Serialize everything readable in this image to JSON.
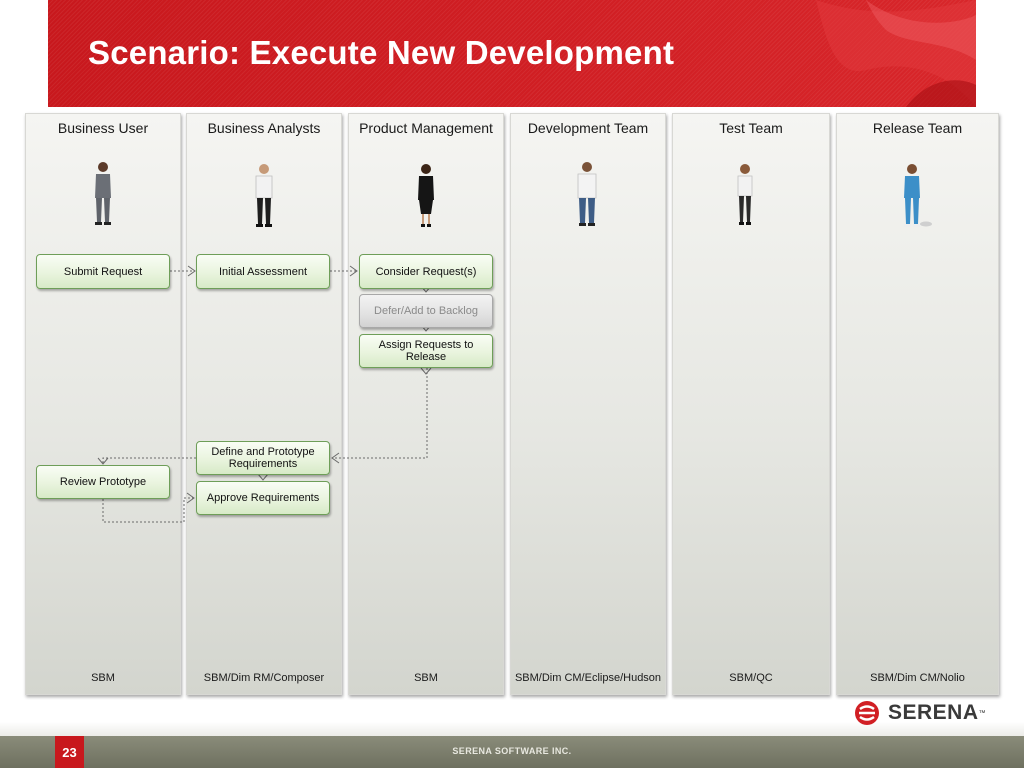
{
  "slide": {
    "title": "Scenario: Execute New Development",
    "page_number": "23",
    "company": "SERENA SOFTWARE INC.",
    "logo_text": "SERENA",
    "logo_tm": "™"
  },
  "colors": {
    "banner_red": "#c8181d",
    "task_border": "#6e9e58",
    "task_fill": "#e9f4de",
    "footer": "#6e705f"
  },
  "lanes": [
    {
      "title": "Business User",
      "tool": "SBM",
      "person_color": "#6b6f76"
    },
    {
      "title": "Business Analysts",
      "tool": "SBM/Dim RM/Composer",
      "person_color": "#1e1e1e"
    },
    {
      "title": "Product Management",
      "tool": "SBM",
      "person_color": "#151515"
    },
    {
      "title": "Development Team",
      "tool": "SBM/Dim CM/Eclipse/Hudson",
      "person_color": "#3e5d86"
    },
    {
      "title": "Test Team",
      "tool": "SBM/QC",
      "person_color": "#2a2a2a"
    },
    {
      "title": "Release Team",
      "tool": "SBM/Dim CM/Nolio",
      "person_color": "#3c8fc8"
    }
  ],
  "tasks": {
    "submit_request": "Submit Request",
    "initial_assessment": "Initial Assessment",
    "consider_requests": "Consider Request(s)",
    "defer_backlog": "Defer/Add to Backlog",
    "assign_requests": "Assign Requests to Release",
    "define_prototype": "Define and Prototype Requirements",
    "review_prototype": "Review Prototype",
    "approve_requirements": "Approve Requirements"
  }
}
